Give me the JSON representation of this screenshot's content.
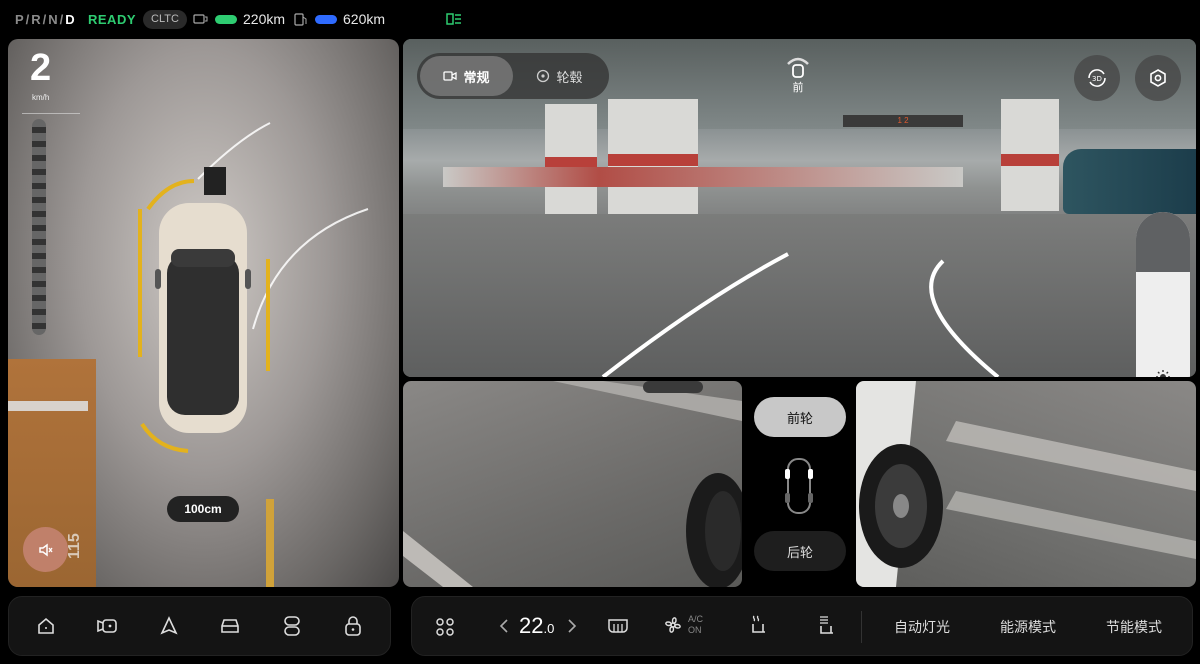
{
  "status": {
    "gear_dim": "P/R/N/",
    "gear_active": "D",
    "ready": "READY",
    "cycle": "CLTC",
    "range_electric": "220km",
    "range_fuel": "620km",
    "colors": {
      "ready": "#2ecc71",
      "electric": "#2ecc71",
      "fuel": "#2f6bff"
    }
  },
  "left_view": {
    "speed": "2",
    "speed_unit": "km/h",
    "distance": "100cm",
    "parking_number": "115",
    "icons": [
      "mute-icon"
    ]
  },
  "front_view": {
    "tabs": [
      {
        "label": "常规",
        "icon": "camera-icon",
        "active": true
      },
      {
        "label": "轮毂",
        "icon": "wheel-icon",
        "active": false
      }
    ],
    "direction": "前",
    "buttons": [
      "3d-view-icon",
      "settings-icon"
    ],
    "slider_icon": "brightness-icon",
    "sign_text": "1 2"
  },
  "wheel_view": {
    "front_wheel": "前轮",
    "rear_wheel": "后轮"
  },
  "bottom_left": {
    "icons": [
      "home-icon",
      "camera-icon",
      "navigation-icon",
      "car-icon",
      "seat-control-icon",
      "lock-icon"
    ]
  },
  "bottom_right": {
    "temperature_int": "22",
    "temperature_dec": ".0",
    "ac_label": "A/C",
    "ac_state": "ON",
    "auto_light": "自动灯光",
    "energy_mode": "能源模式",
    "eco_mode": "节能模式",
    "icons": [
      "apps-icon",
      "chevron-left-icon",
      "chevron-right-icon",
      "rear-defrost-icon",
      "fan-icon",
      "seat-heat-icon",
      "seat-vent-icon"
    ]
  }
}
